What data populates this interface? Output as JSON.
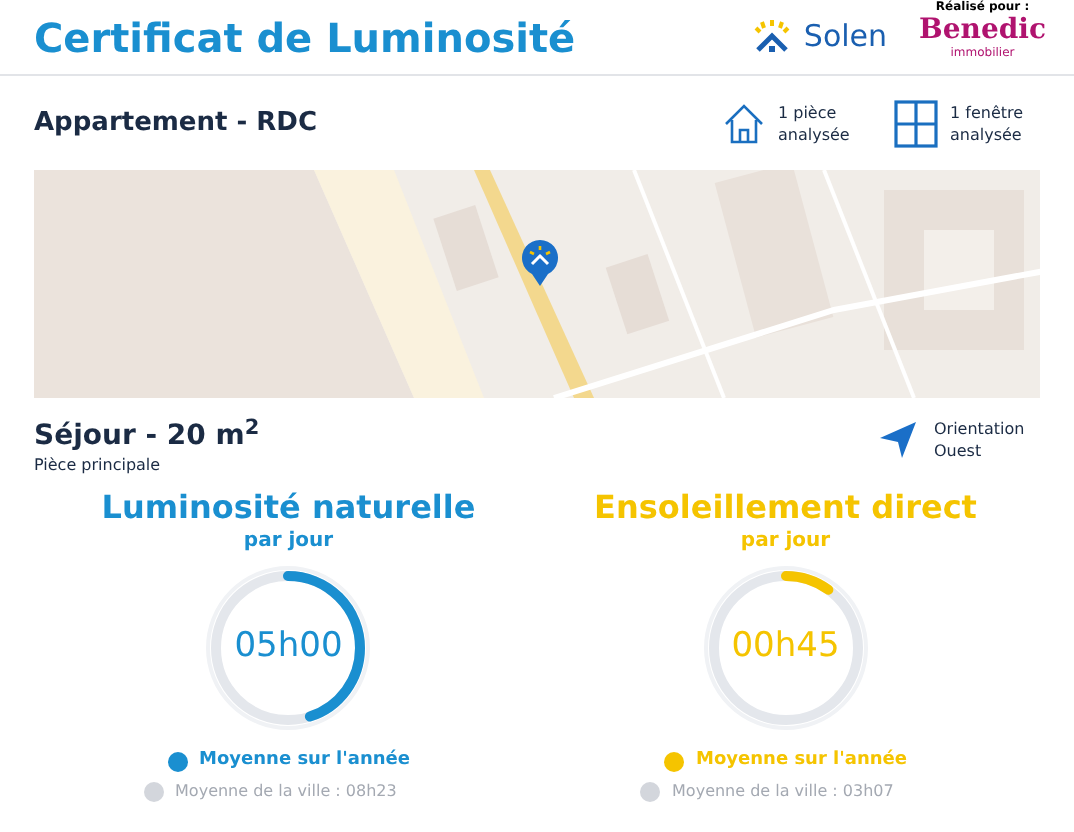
{
  "header": {
    "title": "Certificat de Luminosité",
    "brand": "Solen",
    "made_for": "Réalisé pour :",
    "client": "Benedic",
    "client_sub": "immobilier"
  },
  "property": {
    "name": "Appartement - RDC",
    "stats": [
      {
        "kind": "room",
        "text": "1 pièce analysée"
      },
      {
        "kind": "window",
        "text": "1 fenêtre analysée"
      }
    ]
  },
  "room": {
    "title": "Séjour - 20 m$^{2}$",
    "subtitle": "Pièce principale",
    "orientation": "Orientation Ouest"
  },
  "gauges": [
    {
      "title": "Luminosité naturelle",
      "period": "par jour",
      "value": "05h00",
      "level": 0.45,
      "color": "#1a8fd0",
      "legend": "Moyenne sur l'année",
      "city": "Moyenne de la ville : 08h23"
    },
    {
      "title": "Ensoleillement direct",
      "period": "par jour",
      "value": "00h45",
      "level": 0.1,
      "color": "#f5c400",
      "legend": "Moyenne sur l'année",
      "city": "Moyenne de la ville : 03h07"
    }
  ]
}
